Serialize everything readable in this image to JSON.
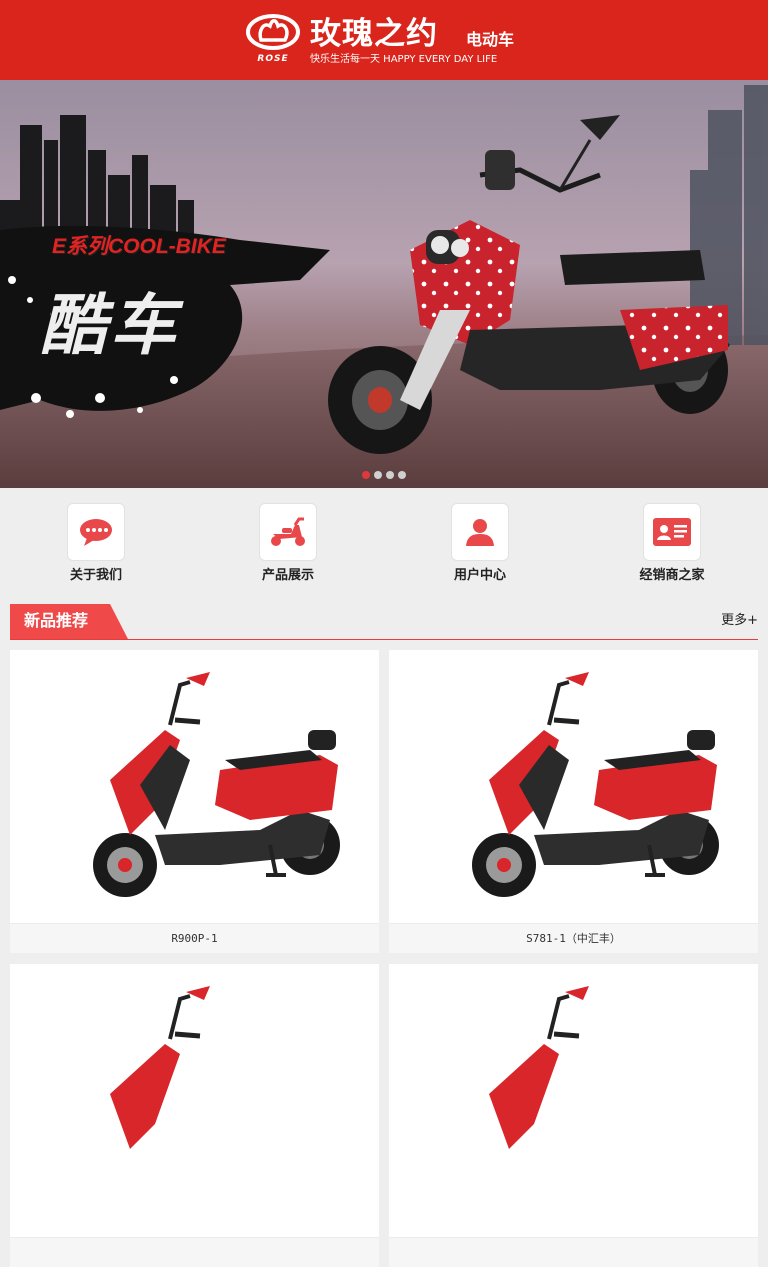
{
  "header": {
    "brand_cn": "玫瑰之约",
    "brand_sub": "电动车",
    "brand_en": "ROSE",
    "slogan": "快乐生活每一天 HAPPY EVERY DAY LIFE",
    "background": "#d9251c"
  },
  "banner": {
    "caption": "E系列COOL-BIKE",
    "headline": "酷车",
    "slide_count": 4,
    "active_slide": 1
  },
  "quick_nav": [
    {
      "label": "关于我们",
      "icon": "chat-bubble-icon"
    },
    {
      "label": "产品展示",
      "icon": "scooter-icon"
    },
    {
      "label": "用户中心",
      "icon": "user-icon"
    },
    {
      "label": "经销商之家",
      "icon": "id-card-icon"
    }
  ],
  "section": {
    "title": "新品推荐",
    "more": "更多+",
    "accent": "#f0494a"
  },
  "products": [
    {
      "name": "R900P-1"
    },
    {
      "name": "S781-1（中汇丰）"
    },
    {
      "name": ""
    },
    {
      "name": ""
    }
  ]
}
